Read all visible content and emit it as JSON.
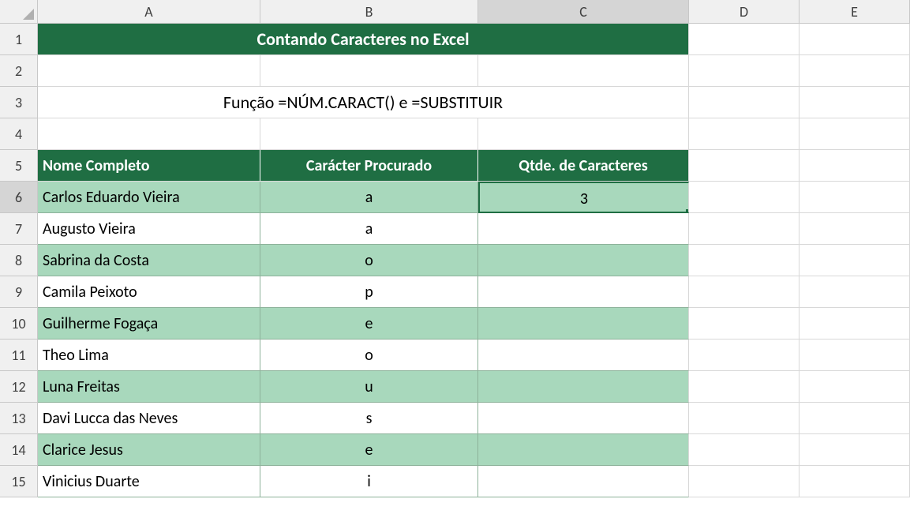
{
  "columns": [
    "A",
    "B",
    "C",
    "D",
    "E"
  ],
  "rows": [
    "1",
    "2",
    "3",
    "4",
    "5",
    "6",
    "7",
    "8",
    "9",
    "10",
    "11",
    "12",
    "13",
    "14",
    "15"
  ],
  "title": "Contando Caracteres no Excel",
  "subtitle": "Função =NÚM.CARACT() e =SUBSTITUIR",
  "headers": {
    "name": "Nome Completo",
    "char": "Carácter Procurado",
    "qty": "Qtde. de Caracteres"
  },
  "data": [
    {
      "name": "Carlos Eduardo Vieira",
      "char": "a",
      "qty": "3"
    },
    {
      "name": "Augusto Vieira",
      "char": "a",
      "qty": ""
    },
    {
      "name": "Sabrina da Costa",
      "char": "o",
      "qty": ""
    },
    {
      "name": "Camila Peixoto",
      "char": "p",
      "qty": ""
    },
    {
      "name": "Guilherme Fogaça",
      "char": "e",
      "qty": ""
    },
    {
      "name": "Theo Lima",
      "char": "o",
      "qty": ""
    },
    {
      "name": "Luna Freitas",
      "char": "u",
      "qty": ""
    },
    {
      "name": "Davi Lucca das Neves",
      "char": "s",
      "qty": ""
    },
    {
      "name": "Clarice Jesus",
      "char": "e",
      "qty": ""
    },
    {
      "name": "Vinicius Duarte",
      "char": "i",
      "qty": ""
    }
  ],
  "chart_data": {
    "type": "table",
    "title": "Contando Caracteres no Excel",
    "columns": [
      "Nome Completo",
      "Carácter Procurado",
      "Qtde. de Caracteres"
    ],
    "rows": [
      [
        "Carlos Eduardo Vieira",
        "a",
        3
      ],
      [
        "Augusto Vieira",
        "a",
        null
      ],
      [
        "Sabrina da Costa",
        "o",
        null
      ],
      [
        "Camila Peixoto",
        "p",
        null
      ],
      [
        "Guilherme Fogaça",
        "e",
        null
      ],
      [
        "Theo Lima",
        "o",
        null
      ],
      [
        "Luna Freitas",
        "u",
        null
      ],
      [
        "Davi Lucca das Neves",
        "s",
        null
      ],
      [
        "Clarice Jesus",
        "e",
        null
      ],
      [
        "Vinicius Duarte",
        "i",
        null
      ]
    ]
  }
}
